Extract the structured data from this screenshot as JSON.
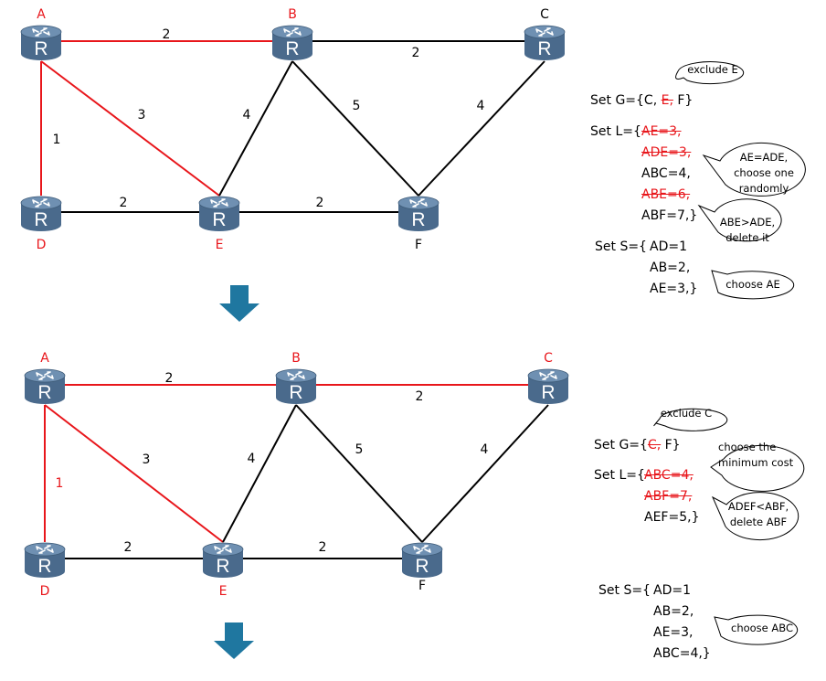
{
  "colors": {
    "highlight": "#e8161b",
    "normal_link": "#000000",
    "router_body": "#4a6a8c",
    "router_top": "#6a8db0",
    "arrow": "#1f77a0"
  },
  "diagrams": [
    {
      "nodes": [
        {
          "id": "A",
          "label": "A",
          "highlighted": true
        },
        {
          "id": "B",
          "label": "B",
          "highlighted": true
        },
        {
          "id": "C",
          "label": "C",
          "highlighted": false
        },
        {
          "id": "D",
          "label": "D",
          "highlighted": true
        },
        {
          "id": "E",
          "label": "E",
          "highlighted": true
        },
        {
          "id": "F",
          "label": "F",
          "highlighted": false
        }
      ],
      "links": [
        {
          "from": "A",
          "to": "B",
          "cost": "2",
          "highlighted": true
        },
        {
          "from": "B",
          "to": "C",
          "cost": "2",
          "highlighted": false
        },
        {
          "from": "A",
          "to": "E",
          "cost": "3",
          "highlighted": true
        },
        {
          "from": "A",
          "to": "D",
          "cost": "1",
          "highlighted": true,
          "label_highlighted": false
        },
        {
          "from": "B",
          "to": "E",
          "cost": "4",
          "highlighted": false
        },
        {
          "from": "B",
          "to": "F",
          "cost": "5",
          "highlighted": false
        },
        {
          "from": "C",
          "to": "F",
          "cost": "4",
          "highlighted": false
        },
        {
          "from": "D",
          "to": "E",
          "cost": "2",
          "highlighted": false
        },
        {
          "from": "E",
          "to": "F",
          "cost": "2",
          "highlighted": false
        }
      ],
      "router_icon_letter": "R"
    },
    {
      "nodes": [
        {
          "id": "A",
          "label": "A",
          "highlighted": true
        },
        {
          "id": "B",
          "label": "B",
          "highlighted": true
        },
        {
          "id": "C",
          "label": "C",
          "highlighted": true
        },
        {
          "id": "D",
          "label": "D",
          "highlighted": true
        },
        {
          "id": "E",
          "label": "E",
          "highlighted": true
        },
        {
          "id": "F",
          "label": "F",
          "highlighted": false
        }
      ],
      "links": [
        {
          "from": "A",
          "to": "B",
          "cost": "2",
          "highlighted": true
        },
        {
          "from": "B",
          "to": "C",
          "cost": "2",
          "highlighted": true
        },
        {
          "from": "A",
          "to": "E",
          "cost": "3",
          "highlighted": true
        },
        {
          "from": "A",
          "to": "D",
          "cost": "1",
          "highlighted": true,
          "label_highlighted": true
        },
        {
          "from": "B",
          "to": "E",
          "cost": "4",
          "highlighted": false
        },
        {
          "from": "B",
          "to": "F",
          "cost": "5",
          "highlighted": false
        },
        {
          "from": "C",
          "to": "F",
          "cost": "4",
          "highlighted": false
        },
        {
          "from": "D",
          "to": "E",
          "cost": "2",
          "highlighted": false
        },
        {
          "from": "E",
          "to": "F",
          "cost": "2",
          "highlighted": false
        }
      ],
      "router_icon_letter": "R"
    }
  ],
  "step1": {
    "set_g_prefix": "Set G={C, ",
    "set_g_struck": "E,",
    "set_g_suffix": " F}",
    "set_l_prefix": "Set L={ ",
    "set_l_items": [
      {
        "text": "AE=3,",
        "struck": true
      },
      {
        "text": "ADE=3,",
        "struck": true
      },
      {
        "text": "ABC=4,",
        "struck": false
      },
      {
        "text": "ABE=6,",
        "struck": true
      },
      {
        "text": "ABF=7,}",
        "struck": false
      }
    ],
    "set_s_prefix": "Set S={ ",
    "set_s_items": [
      "AD=1",
      "AB=2,",
      "AE=3,}"
    ],
    "bubbles": {
      "exclude": "exclude E",
      "tie": [
        "AE=ADE,",
        "choose one",
        "randomly"
      ],
      "delete": [
        "ABE>ADE,",
        "delete it"
      ],
      "choose": "choose AE"
    }
  },
  "step2": {
    "set_g_prefix": "Set G={",
    "set_g_struck": "C,",
    "set_g_suffix": " F}",
    "set_l_prefix": "Set L={ ",
    "set_l_items": [
      {
        "text": "ABC=4,",
        "struck": true
      },
      {
        "text": "ABF=7,",
        "struck": true
      },
      {
        "text": "AEF=5,}",
        "struck": false
      }
    ],
    "set_s_prefix": "Set S={ ",
    "set_s_items": [
      "AD=1",
      "AB=2,",
      "AE=3,",
      "ABC=4,}"
    ],
    "bubbles": {
      "exclude": "exclude C",
      "min": [
        "choose the",
        "minimum cost"
      ],
      "delete": [
        "ADEF<ABF,",
        "delete ABF"
      ],
      "choose": "choose ABC"
    }
  }
}
